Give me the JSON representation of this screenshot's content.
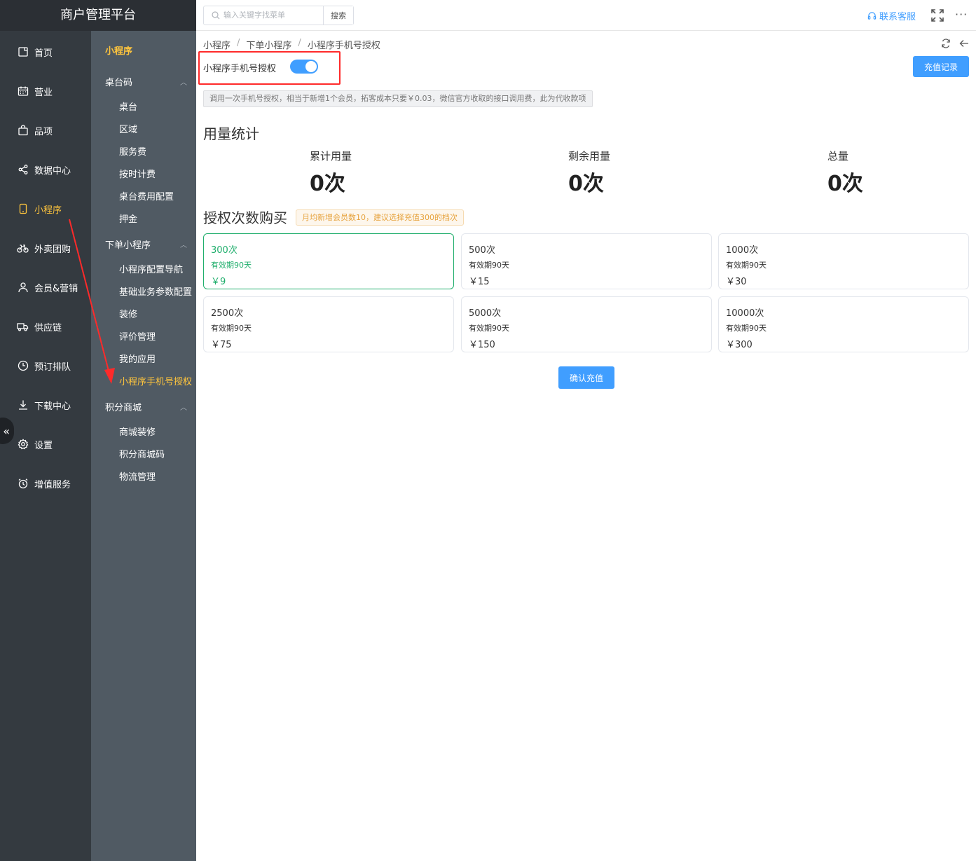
{
  "app": {
    "title": "商户管理平台"
  },
  "nav": {
    "items": [
      {
        "label": "首页",
        "icon": "home-icon"
      },
      {
        "label": "营业",
        "icon": "calendar-icon"
      },
      {
        "label": "品项",
        "icon": "bag-icon"
      },
      {
        "label": "数据中心",
        "icon": "share-icon"
      },
      {
        "label": "小程序",
        "icon": "phone-icon",
        "active": true
      },
      {
        "label": "外卖团购",
        "icon": "bike-icon"
      },
      {
        "label": "会员&营销",
        "icon": "user-icon"
      },
      {
        "label": "供应链",
        "icon": "truck-icon"
      },
      {
        "label": "预订排队",
        "icon": "clock-icon"
      },
      {
        "label": "下载中心",
        "icon": "download-icon"
      },
      {
        "label": "设置",
        "icon": "gear-icon"
      },
      {
        "label": "增值服务",
        "icon": "alarm-icon"
      }
    ],
    "collapse_glyph": "«"
  },
  "subnav": {
    "title": "小程序",
    "groups": [
      {
        "label": "桌台码",
        "items": [
          "桌台",
          "区域",
          "服务费",
          "按时计费",
          "桌台费用配置",
          "押金"
        ]
      },
      {
        "label": "下单小程序",
        "items": [
          "小程序配置导航",
          "基础业务参数配置",
          "装修",
          "评价管理",
          "我的应用",
          "小程序手机号授权"
        ]
      },
      {
        "label": "积分商城",
        "items": [
          "商城装修",
          "积分商城码",
          "物流管理"
        ]
      }
    ],
    "active_item": "小程序手机号授权"
  },
  "topbar": {
    "search_placeholder": "输入关键字找菜单",
    "search_button": "搜索",
    "contact": "联系客服",
    "more": "···"
  },
  "breadcrumb": [
    "小程序",
    "下单小程序",
    "小程序手机号授权"
  ],
  "auth": {
    "label": "小程序手机号授权",
    "enabled": true
  },
  "recharge_log_button": "充值记录",
  "notice": "调用一次手机号授权，相当于新增1个会员，拓客成本只要￥0.03，微信官方收取的接口调用费，此为代收款项",
  "usage": {
    "heading": "用量统计",
    "stats": [
      {
        "label": "累计用量",
        "value": "0次"
      },
      {
        "label": "剩余用量",
        "value": "0次"
      },
      {
        "label": "总量",
        "value": "0次"
      }
    ]
  },
  "purchase": {
    "heading": "授权次数购买",
    "tip": "月均新增会员数10，建议选择充值300的档次",
    "packages": [
      {
        "count": "300次",
        "validity": "有效期90天",
        "price": "￥9",
        "selected": true
      },
      {
        "count": "500次",
        "validity": "有效期90天",
        "price": "￥15"
      },
      {
        "count": "1000次",
        "validity": "有效期90天",
        "price": "￥30"
      },
      {
        "count": "2500次",
        "validity": "有效期90天",
        "price": "￥75"
      },
      {
        "count": "5000次",
        "validity": "有效期90天",
        "price": "￥150"
      },
      {
        "count": "10000次",
        "validity": "有效期90天",
        "price": "￥300"
      }
    ],
    "confirm_button": "确认充值"
  },
  "colors": {
    "primary": "#409eff",
    "active_nav": "#ffc53d",
    "selected": "#1fae6c",
    "annotation": "#ff2a2a"
  }
}
